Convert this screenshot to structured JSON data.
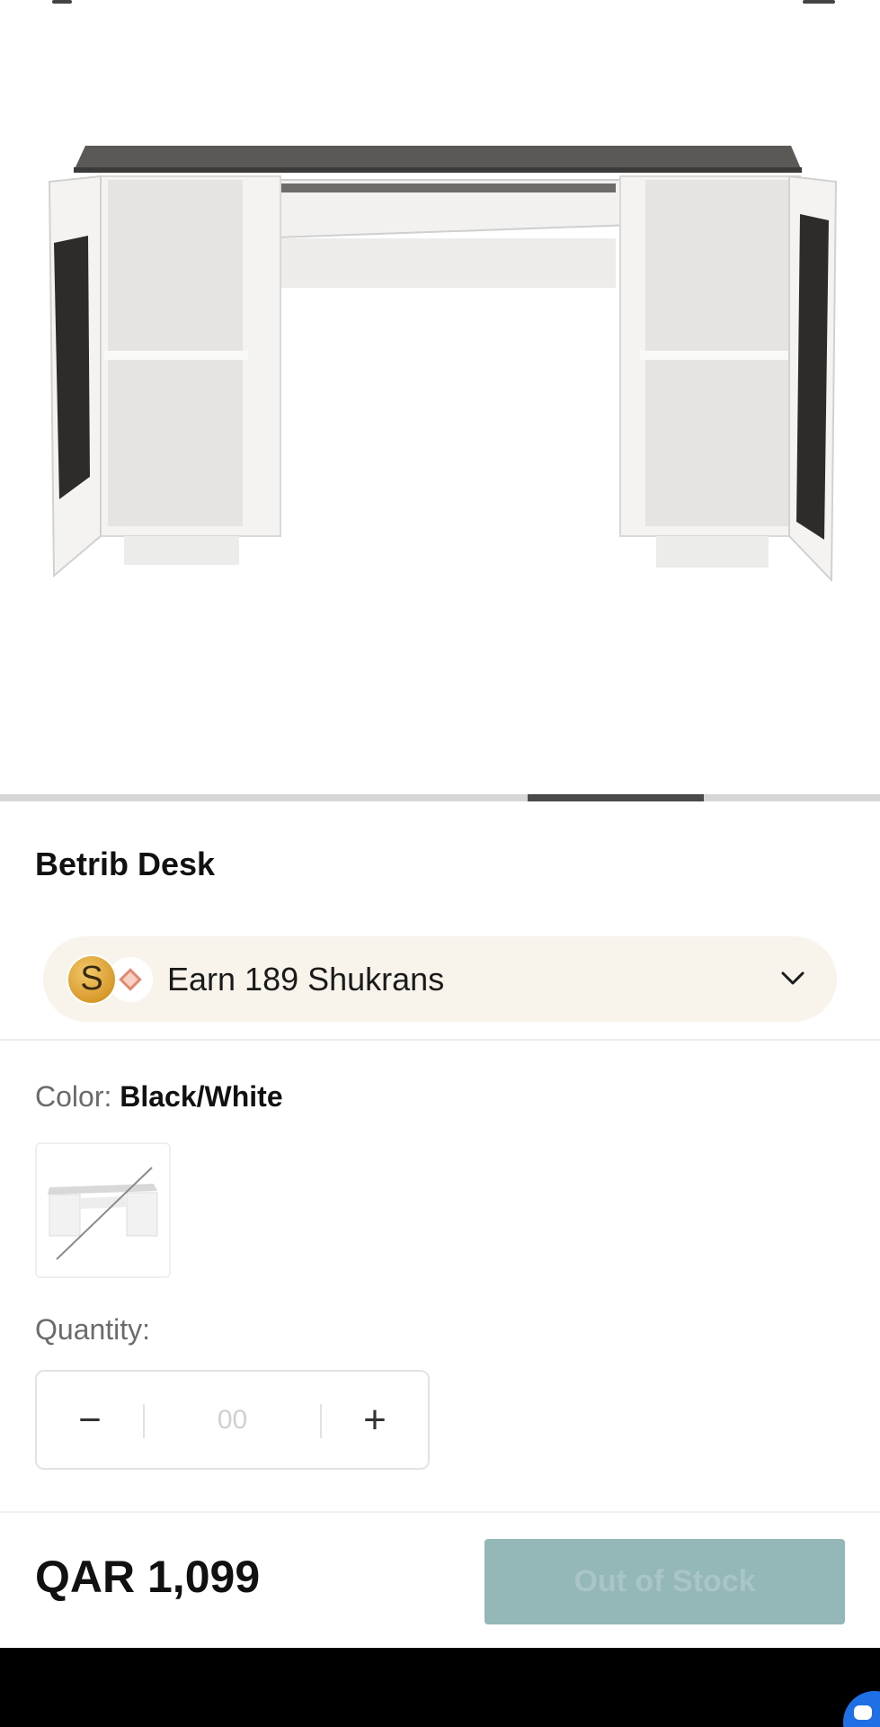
{
  "product": {
    "title": "Betrib Desk",
    "image_alt": "desk-photo"
  },
  "carousel": {
    "active_index": 3,
    "total": 5
  },
  "rewards": {
    "coin_letter": "S",
    "text": "Earn 189 Shukrans"
  },
  "color": {
    "label": "Color:",
    "value": "Black/White"
  },
  "quantity": {
    "label": "Quantity:",
    "value": "00",
    "minus": "−",
    "plus": "+"
  },
  "footer": {
    "price": "QAR 1,099",
    "button_label": "Out of Stock"
  },
  "colors": {
    "button_bg": "#93b8b7",
    "rewards_bg": "#f8f4ec",
    "chat_blue": "#1f6fe5"
  }
}
